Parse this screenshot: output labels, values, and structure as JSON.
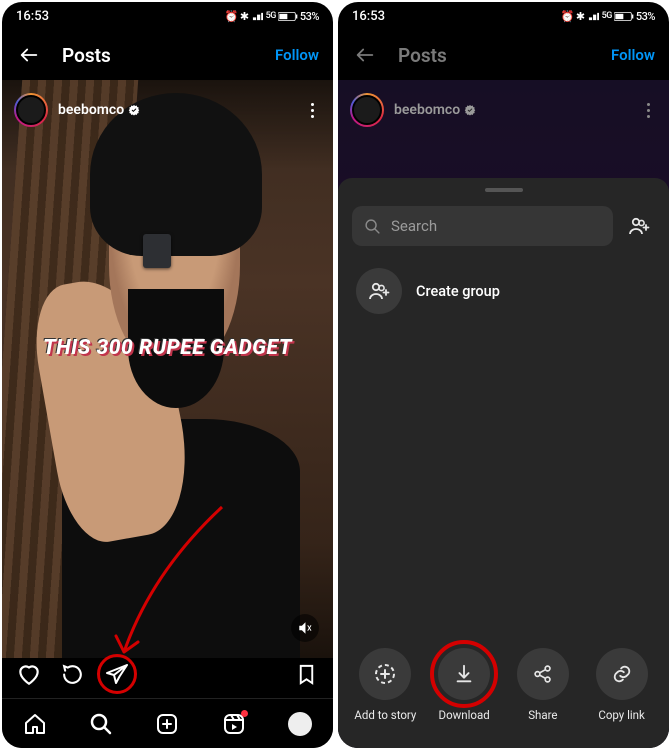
{
  "status": {
    "time": "16:53",
    "battery": "53%",
    "indicators": "⏰ ✱ ᯤ ⁵ᴳ ᵇ⬛"
  },
  "header": {
    "title": "Posts",
    "follow": "Follow"
  },
  "profile": {
    "username": "beebomco"
  },
  "reel": {
    "caption": "THIS 300 RUPEE GADGET"
  },
  "sheet": {
    "search_placeholder": "Search",
    "create_group": "Create group"
  },
  "share": {
    "add_to_story": "Add to story",
    "download": "Download",
    "share": "Share",
    "copy_link": "Copy link"
  }
}
